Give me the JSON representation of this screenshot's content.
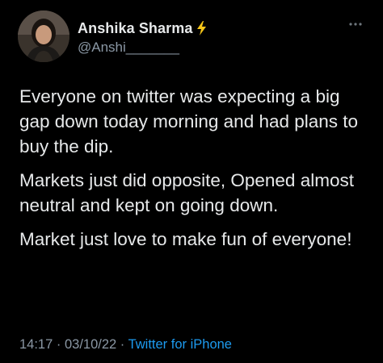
{
  "author": {
    "display_name": "Anshika Sharma",
    "verified_icon": "lightning-bolt-icon",
    "handle": "@Anshi_______"
  },
  "header": {
    "more_icon": "more-options-icon"
  },
  "tweet": {
    "paragraphs": [
      "Everyone on twitter was expecting a big gap down today morning and had plans to buy the dip.",
      "Markets just did opposite, Opened almost neutral and kept on going down.",
      "Market just love to make fun of everyone!"
    ]
  },
  "meta": {
    "time": "14:17",
    "separator": " · ",
    "date": "03/10/22",
    "source": "Twitter for iPhone"
  },
  "colors": {
    "background": "#000000",
    "text": "#e7e9ea",
    "secondary": "#8b98a5",
    "link": "#1d9bf0",
    "bolt": "#f5c518"
  }
}
